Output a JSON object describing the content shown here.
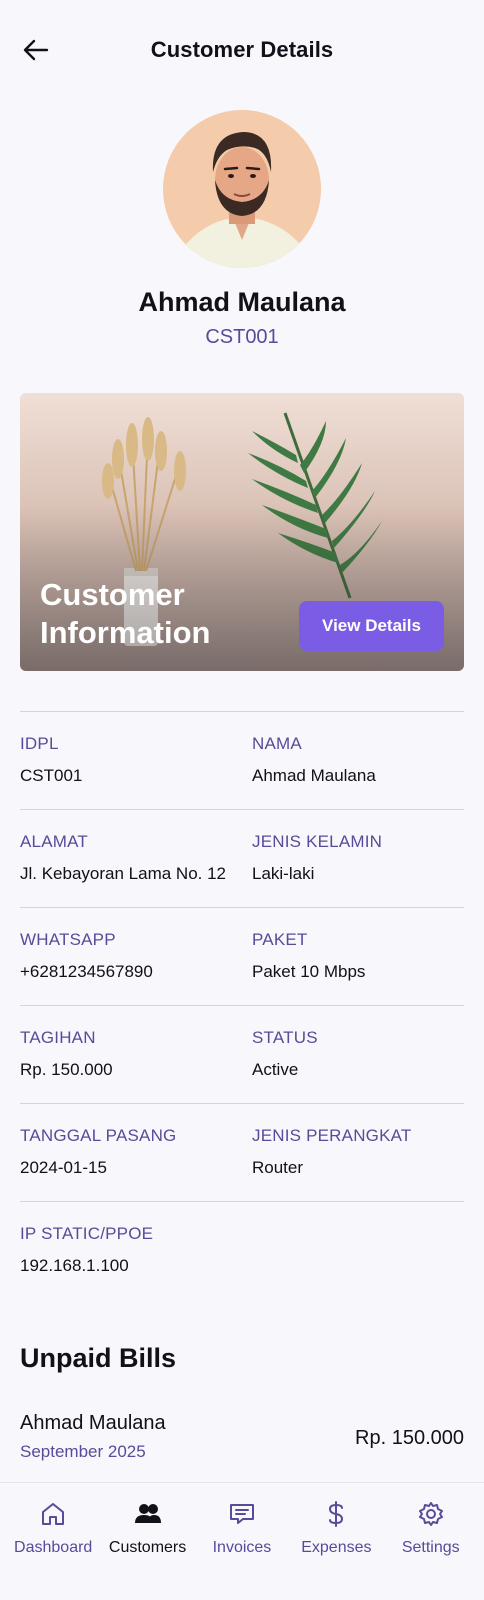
{
  "header": {
    "title": "Customer Details"
  },
  "profile": {
    "name": "Ahmad Maulana",
    "id": "CST001"
  },
  "banner": {
    "title": "Customer Information",
    "button_label": "View Details"
  },
  "info": {
    "rows": [
      [
        {
          "label": "IDPL",
          "value": "CST001"
        },
        {
          "label": "NAMA",
          "value": "Ahmad Maulana"
        }
      ],
      [
        {
          "label": "ALAMAT",
          "value": "Jl. Kebayoran Lama No. 12"
        },
        {
          "label": "JENIS KELAMIN",
          "value": "Laki-laki"
        }
      ],
      [
        {
          "label": "WHATSAPP",
          "value": "+6281234567890"
        },
        {
          "label": "PAKET",
          "value": "Paket 10 Mbps"
        }
      ],
      [
        {
          "label": "TAGIHAN",
          "value": "Rp. 150.000"
        },
        {
          "label": "STATUS",
          "value": "Active"
        }
      ],
      [
        {
          "label": "TANGGAL PASANG",
          "value": "2024-01-15"
        },
        {
          "label": "JENIS PERANGKAT",
          "value": "Router"
        }
      ],
      [
        {
          "label": "IP STATIC/PPOE",
          "value": "192.168.1.100"
        }
      ]
    ]
  },
  "unpaid": {
    "title": "Unpaid Bills",
    "bills": [
      {
        "name": "Ahmad Maulana",
        "period": "September 2025",
        "amount": "Rp. 150.000"
      }
    ]
  },
  "nav": {
    "items": [
      {
        "label": "Dashboard",
        "icon": "home-icon"
      },
      {
        "label": "Customers",
        "icon": "users-icon",
        "active": true
      },
      {
        "label": "Invoices",
        "icon": "invoice-icon"
      },
      {
        "label": "Expenses",
        "icon": "dollar-icon"
      },
      {
        "label": "Settings",
        "icon": "gear-icon"
      }
    ]
  },
  "colors": {
    "accent": "#7b5ce5",
    "label": "#5a4a9a",
    "text": "#121018",
    "background": "#f8f7fb"
  }
}
